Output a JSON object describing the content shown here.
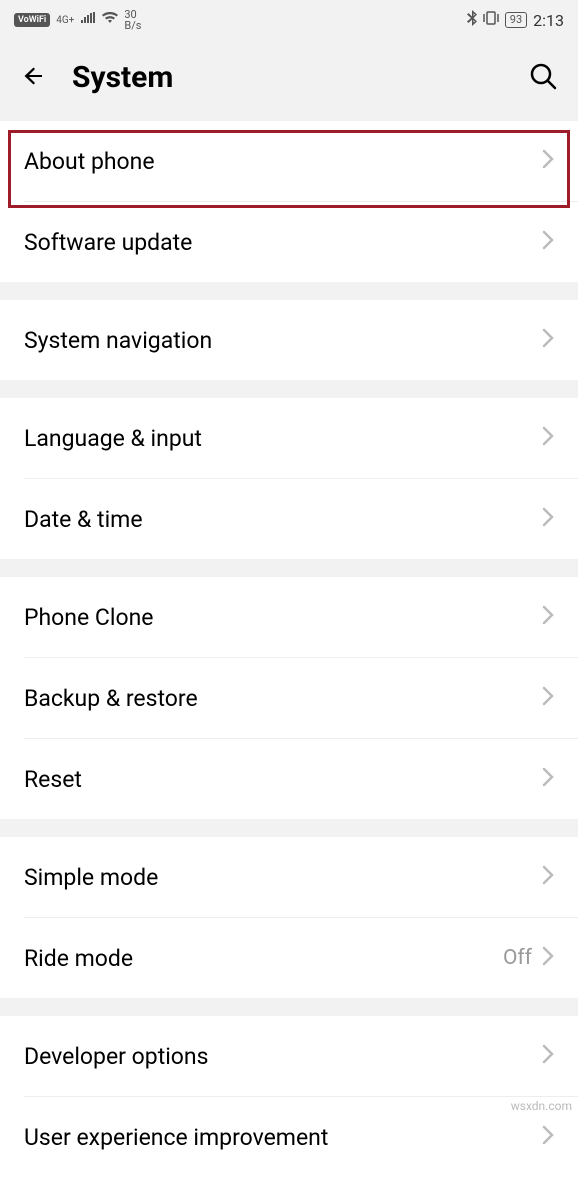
{
  "status": {
    "vowifi": "VoWiFi",
    "net4g": "4G+",
    "speed_num": "30",
    "speed_unit": "B/s",
    "battery": "93",
    "time": "2:13"
  },
  "header": {
    "title": "System"
  },
  "groups": [
    {
      "rows": [
        {
          "key": "about-phone",
          "label": "About phone",
          "highlight": true
        },
        {
          "key": "software-update",
          "label": "Software update"
        }
      ]
    },
    {
      "rows": [
        {
          "key": "system-navigation",
          "label": "System navigation"
        }
      ]
    },
    {
      "rows": [
        {
          "key": "language-input",
          "label": "Language & input"
        },
        {
          "key": "date-time",
          "label": "Date & time"
        }
      ]
    },
    {
      "rows": [
        {
          "key": "phone-clone",
          "label": "Phone Clone"
        },
        {
          "key": "backup-restore",
          "label": "Backup & restore"
        },
        {
          "key": "reset",
          "label": "Reset"
        }
      ]
    },
    {
      "rows": [
        {
          "key": "simple-mode",
          "label": "Simple mode"
        },
        {
          "key": "ride-mode",
          "label": "Ride mode",
          "value": "Off"
        }
      ]
    },
    {
      "rows": [
        {
          "key": "developer-options",
          "label": "Developer options"
        },
        {
          "key": "user-experience-improvement",
          "label": "User experience improvement"
        }
      ]
    }
  ],
  "watermark": "wsxdn.com"
}
